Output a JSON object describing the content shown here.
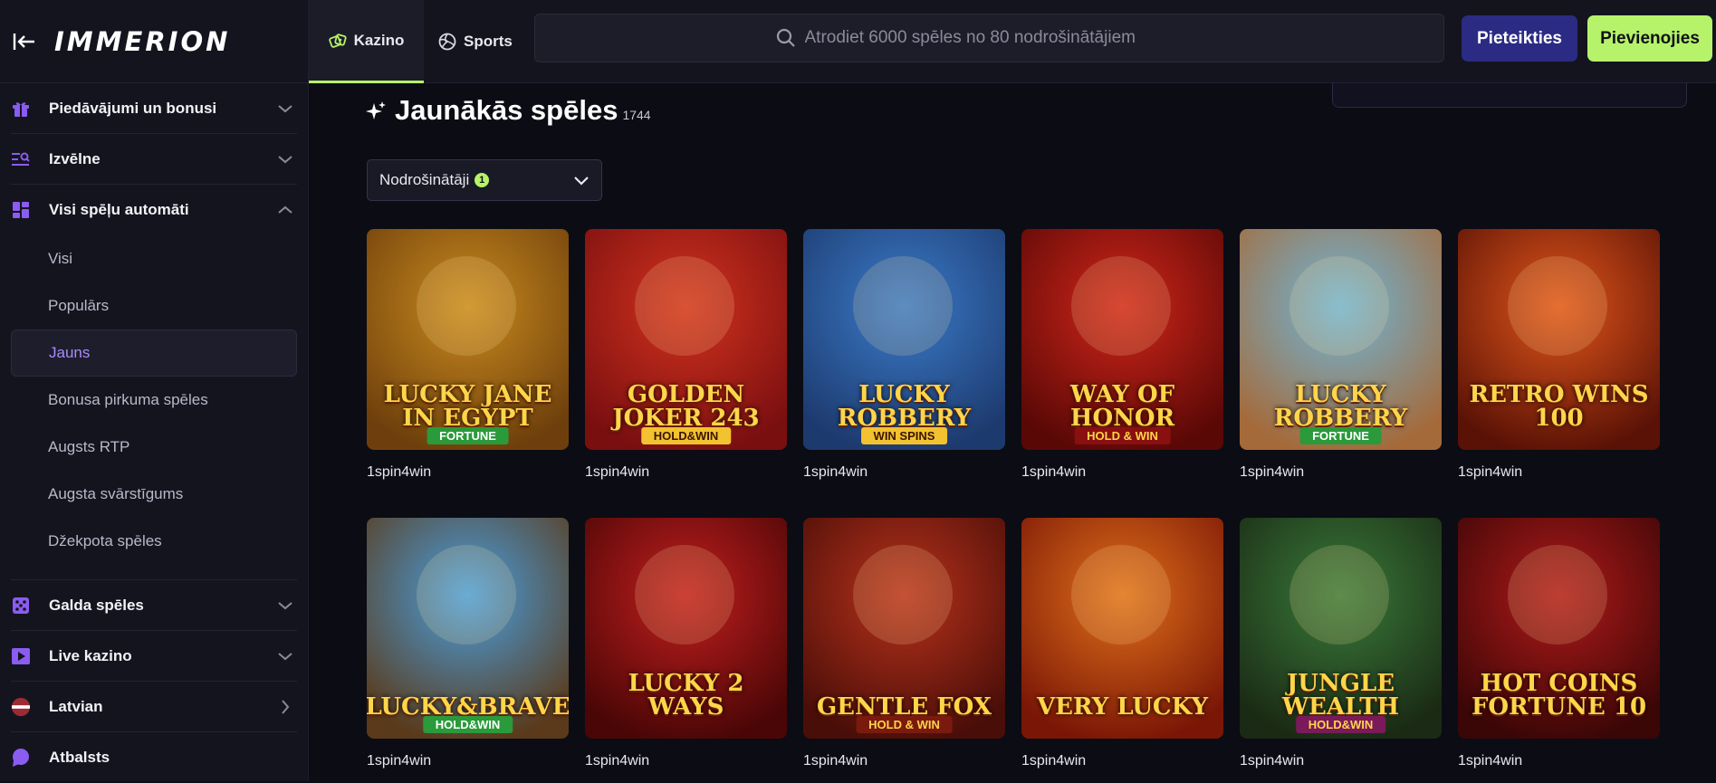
{
  "header": {
    "logo": "IMMERION",
    "tabs": [
      {
        "label": "Kazino",
        "active": true
      },
      {
        "label": "Sports",
        "active": false
      }
    ],
    "search_placeholder": "Atrodiet 6000 spēles no 80 nodrošinātājiem",
    "login_label": "Pieteikties",
    "join_label": "Pievienojies"
  },
  "sidebar": {
    "sections": [
      {
        "label": "Piedāvājumi un bonusi",
        "icon": "gift-icon"
      },
      {
        "label": "Izvēlne",
        "icon": "menu-search-icon"
      },
      {
        "label": "Visi spēļu automāti",
        "icon": "grid-icon",
        "expanded": true
      }
    ],
    "sub_items": [
      {
        "label": "Visi"
      },
      {
        "label": "Populārs"
      },
      {
        "label": "Jauns",
        "active": true
      },
      {
        "label": "Bonusa pirkuma spēles"
      },
      {
        "label": "Augsts RTP"
      },
      {
        "label": "Augsta svārstīgums"
      },
      {
        "label": "Džekpota spēles"
      }
    ],
    "bottom_sections": [
      {
        "label": "Galda spēles",
        "icon": "dice-icon"
      },
      {
        "label": "Live kazino",
        "icon": "play-icon"
      },
      {
        "label": "Latvian",
        "icon": "flag-icon"
      },
      {
        "label": "Atbalsts",
        "icon": "chat-icon"
      }
    ]
  },
  "main": {
    "title": "Jaunākās spēles",
    "count": "1744",
    "filter_label": "Nodrošinātāji",
    "filter_badge": "1",
    "games": [
      {
        "name": "LUCKY JANE IN EGYPT",
        "tag": "FORTUNE",
        "provider": "1spin4win",
        "bg": "#c98a1e",
        "bg2": "#6e3f0c",
        "tagbg": "#2a9a3a",
        "tagfg": "#ffffff"
      },
      {
        "name": "GOLDEN JOKER 243",
        "tag": "HOLD&WIN",
        "provider": "1spin4win",
        "bg": "#d2321e",
        "bg2": "#7a0f10",
        "tagbg": "#f2c230",
        "tagfg": "#3a1500"
      },
      {
        "name": "LUCKY ROBBERY",
        "tag": "WIN SPINS",
        "provider": "1spin4win",
        "bg": "#3a7ac8",
        "bg2": "#1d3a6e",
        "tagbg": "#f2c230",
        "tagfg": "#3a1500"
      },
      {
        "name": "WAY OF HONOR",
        "tag": "HOLD & WIN",
        "provider": "1spin4win",
        "bg": "#d0261a",
        "bg2": "#5a0806",
        "tagbg": "#8a0f10",
        "tagfg": "#ffd54a"
      },
      {
        "name": "LUCKY ROBBERY",
        "tag": "FORTUNE",
        "provider": "1spin4win",
        "bg": "#6fb6d8",
        "bg2": "#a56a3a",
        "tagbg": "#2a9a3a",
        "tagfg": "#ffffff"
      },
      {
        "name": "RETRO WINS 100",
        "tag": "",
        "provider": "1spin4win",
        "bg": "#e0551a",
        "bg2": "#5a1206",
        "tagbg": "",
        "tagfg": ""
      },
      {
        "name": "LUCKY&BRAVE",
        "tag": "HOLD&WIN",
        "provider": "1spin4win",
        "bg": "#4aa0e0",
        "bg2": "#5a3a1a",
        "tagbg": "#2a9a3a",
        "tagfg": "#ffffff"
      },
      {
        "name": "LUCKY 2 WAYS",
        "tag": "",
        "provider": "1spin4win",
        "bg": "#c21e1e",
        "bg2": "#4a0606",
        "tagbg": "",
        "tagfg": ""
      },
      {
        "name": "GENTLE FOX",
        "tag": "HOLD & WIN",
        "provider": "1spin4win",
        "bg": "#b8321c",
        "bg2": "#4a0e08",
        "tagbg": "#7a1a0e",
        "tagfg": "#ffd54a"
      },
      {
        "name": "VERY LUCKY",
        "tag": "",
        "provider": "1spin4win",
        "bg": "#e0701a",
        "bg2": "#7a1606",
        "tagbg": "",
        "tagfg": ""
      },
      {
        "name": "JUNGLE WEALTH",
        "tag": "HOLD&WIN",
        "provider": "1spin4win",
        "bg": "#3a7a3a",
        "bg2": "#1a2a14",
        "tagbg": "#7a1a5a",
        "tagfg": "#ffd54a"
      },
      {
        "name": "HOT COINS FORTUNE 10",
        "tag": "",
        "provider": "1spin4win",
        "bg": "#b01a1a",
        "bg2": "#3a0606",
        "tagbg": "",
        "tagfg": ""
      }
    ]
  },
  "colors": {
    "accent_green": "#b6f36a",
    "accent_purple": "#a98bff",
    "login_bg": "#2b2b84"
  }
}
